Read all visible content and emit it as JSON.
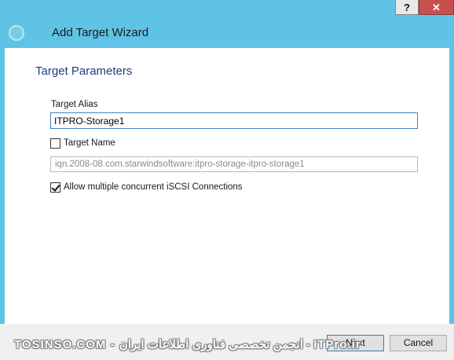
{
  "window": {
    "title": "Add Target Wizard",
    "help_label": "?",
    "close_label": "✕"
  },
  "page": {
    "heading": "Target Parameters"
  },
  "form": {
    "alias_label": "Target Alias",
    "alias_value": "ITPRO-Storage1",
    "target_name_label": "Target Name",
    "target_name_checked": false,
    "target_name_value": "iqn.2008-08.com.starwindsoftware:itpro-storage-itpro-storage1",
    "multi_conn_label": "Allow multiple concurrent iSCSI Connections",
    "multi_conn_checked": true
  },
  "footer": {
    "next_label": "Next",
    "cancel_label": "Cancel",
    "watermark": "TOSINSO.COM - انجمن تخصصی فناوری اطلاعات ایران - ITPro.ir"
  },
  "colors": {
    "title_bar": "#5fc3e6",
    "heading": "#1e3e7d",
    "focus_border": "#3e84c7",
    "close_button": "#c7504c"
  }
}
